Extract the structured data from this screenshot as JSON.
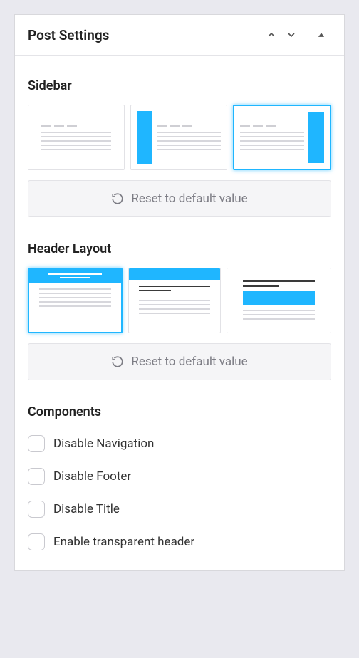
{
  "panel": {
    "title": "Post Settings"
  },
  "sections": {
    "sidebar": {
      "label": "Sidebar",
      "reset_label": "Reset to default value"
    },
    "header_layout": {
      "label": "Header Layout",
      "reset_label": "Reset to default value"
    },
    "components": {
      "label": "Components",
      "items": [
        {
          "label": "Disable Navigation"
        },
        {
          "label": "Disable Footer"
        },
        {
          "label": "Disable Title"
        },
        {
          "label": "Enable transparent header"
        }
      ]
    }
  }
}
